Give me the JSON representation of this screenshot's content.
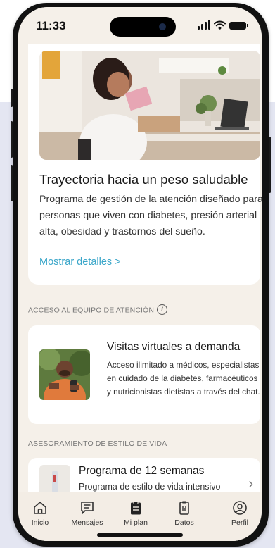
{
  "status_bar": {
    "time": "11:33"
  },
  "program_card": {
    "title": "Trayectoria hacia un peso saludable",
    "description": "Programa de gestión de la atención diseñado para personas que viven con diabetes, presión arterial alta, obesidad y trastornos del sueño.",
    "link_label": "Mostrar detalles >"
  },
  "care_team_section": {
    "header": "ACCESO AL EQUIPO DE ATENCIÓN",
    "info_glyph": "i",
    "card": {
      "title": "Visitas virtuales a demanda",
      "description": "Acceso ilimitado a médicos, especialistas en cuidado de la diabetes, farmacéuticos y nutricionistas dietistas a través del chat."
    }
  },
  "lifestyle_section": {
    "header": "ASESORAMIENTO DE ESTILO DE VIDA",
    "card": {
      "title": "Programa de 12 semanas",
      "subtitle": "Programa de estilo de vida intensivo",
      "chevron": "›"
    }
  },
  "tab_bar": {
    "items": [
      {
        "label": "Inicio",
        "icon": "home-icon"
      },
      {
        "label": "Mensajes",
        "icon": "messages-icon"
      },
      {
        "label": "Mi plan",
        "icon": "clipboard-icon"
      },
      {
        "label": "Datos",
        "icon": "data-icon"
      },
      {
        "label": "Perfil",
        "icon": "profile-icon"
      }
    ]
  },
  "colors": {
    "link": "#3aa6c9",
    "screen_bg": "#f5f0e9",
    "tab_bar_bg": "#f3ede5",
    "page_bg": "#e4e6f2"
  }
}
